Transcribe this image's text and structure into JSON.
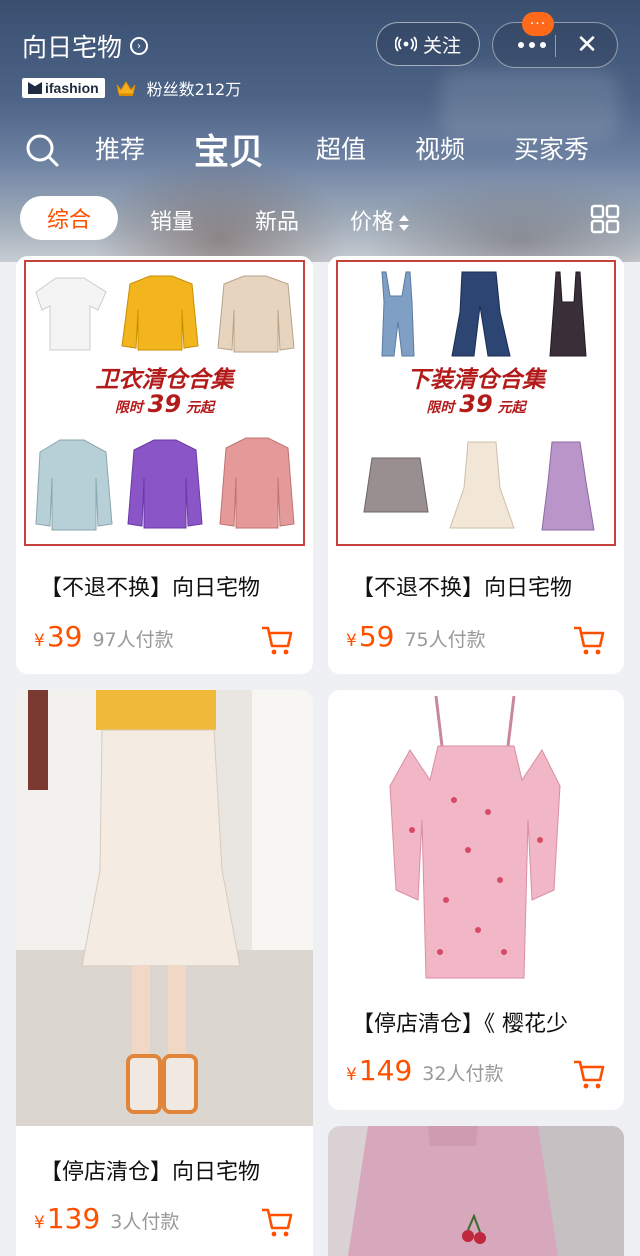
{
  "header": {
    "store_name": "向日宅物",
    "brand_badge": "ifashion",
    "fans": "粉丝数212万",
    "follow_label": "关注",
    "notify_badge": "···"
  },
  "tabs": [
    {
      "label": "推荐",
      "active": false
    },
    {
      "label": "宝贝",
      "active": true
    },
    {
      "label": "超值",
      "active": false
    },
    {
      "label": "视频",
      "active": false
    },
    {
      "label": "买家秀",
      "active": false
    }
  ],
  "filters": [
    {
      "label": "综合",
      "active": true
    },
    {
      "label": "销量",
      "active": false
    },
    {
      "label": "新品",
      "active": false
    },
    {
      "label": "价格",
      "active": false
    }
  ],
  "products": [
    {
      "title": "【不退不换】向日宅物",
      "currency": "¥",
      "price": "39",
      "sold": "97人付款",
      "banner_title": "卫衣清仓合集",
      "banner_prefix": "限时",
      "banner_price": "39",
      "banner_suffix": "元起"
    },
    {
      "title": "【不退不换】向日宅物",
      "currency": "¥",
      "price": "59",
      "sold": "75人付款",
      "banner_title": "下装清仓合集",
      "banner_prefix": "限时",
      "banner_price": "39",
      "banner_suffix": "元起"
    },
    {
      "title": "【停店清仓】向日宅物",
      "currency": "¥",
      "price": "139",
      "sold": "3人付款"
    },
    {
      "title": "【停店清仓】《 樱花少",
      "currency": "¥",
      "price": "149",
      "sold": "32人付款"
    }
  ],
  "colors": {
    "accent": "#ff5000",
    "banner_red": "#b31b1b"
  }
}
